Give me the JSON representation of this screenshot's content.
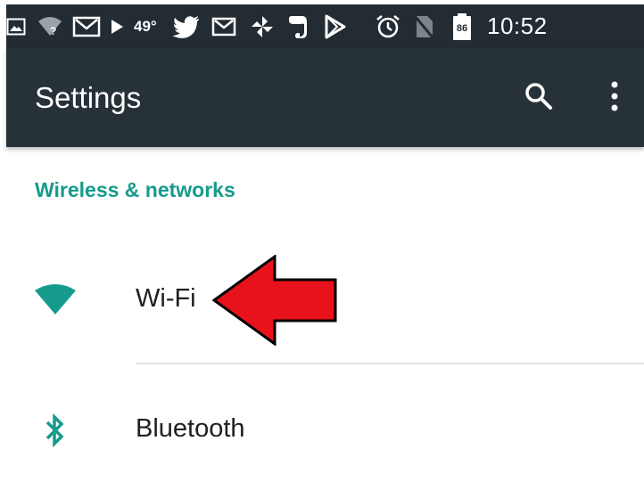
{
  "status_bar": {
    "temperature": "49°",
    "battery_level": "86",
    "time": "10:52",
    "icons": [
      "gallery-icon",
      "wifi-unknown-icon",
      "gmail-icon",
      "play-icon",
      "twitter-icon",
      "gmail-icon",
      "pinwheel-icon",
      "evernote-icon",
      "play-store-icon",
      "alarm-icon",
      "no-sim-icon",
      "battery-icon"
    ]
  },
  "toolbar": {
    "title": "Settings",
    "search_icon": "search-icon",
    "menu_icon": "more-vert-icon"
  },
  "section": {
    "header": "Wireless & networks"
  },
  "items": [
    {
      "label": "Wi-Fi",
      "icon": "wifi-icon"
    },
    {
      "label": "Bluetooth",
      "icon": "bluetooth-icon"
    }
  ],
  "annotation": {
    "arrow_icon": "red-arrow-icon"
  },
  "colors": {
    "status_bar_bg": "#222c32",
    "toolbar_bg": "#273238",
    "accent": "#159b8c",
    "arrow_fill": "#e8121c",
    "text_primary": "#202020"
  }
}
